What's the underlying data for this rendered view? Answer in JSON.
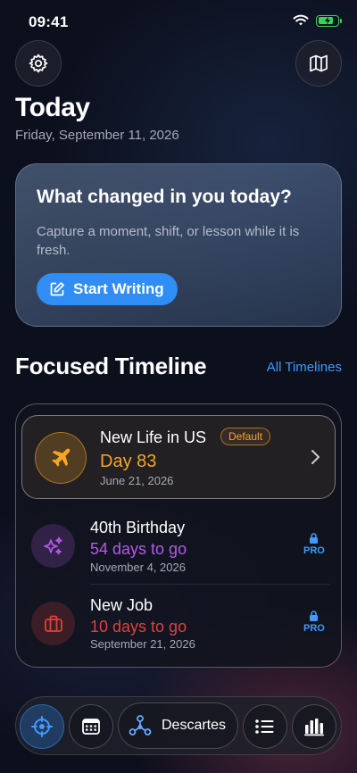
{
  "status_bar": {
    "time": "09:41",
    "battery_level": 0.8
  },
  "header": {
    "settings_icon": "gear-icon",
    "map_icon": "map-icon",
    "title": "Today",
    "date": "Friday, September 11, 2026"
  },
  "prompt": {
    "title": "What changed in you today?",
    "subtitle": "Capture a moment, shift, or lesson while it is fresh.",
    "button_label": "Start Writing",
    "button_icon": "compose-icon"
  },
  "focused": {
    "section_title": "Focused Timeline",
    "all_link": "All Timelines"
  },
  "events": [
    {
      "name": "New Life in US",
      "badge": "Default",
      "big": "Day 83",
      "date": "June 21, 2026",
      "icon": "airplane-icon",
      "color": "#f5a623"
    },
    {
      "name": "40th Birthday",
      "big": "54 days to go",
      "date": "November 4, 2026",
      "icon": "sparkles-icon",
      "color": "#b45ae8",
      "pro": "PRO"
    },
    {
      "name": "New Job",
      "big": "10 days to go",
      "date": "September 21, 2026",
      "icon": "briefcase-icon",
      "color": "#e0413b",
      "pro": "PRO"
    }
  ],
  "tabbar": {
    "tabs": [
      {
        "icon": "crosshair-icon",
        "active": true
      },
      {
        "icon": "calendar-icon"
      },
      {
        "icon": "network-icon",
        "label": "Descartes"
      },
      {
        "icon": "list-icon"
      },
      {
        "icon": "bar-chart-icon"
      }
    ]
  },
  "colors": {
    "accent": "#2f8df4",
    "orange": "#f5a623",
    "purple": "#b45ae8",
    "red": "#e0413b"
  }
}
